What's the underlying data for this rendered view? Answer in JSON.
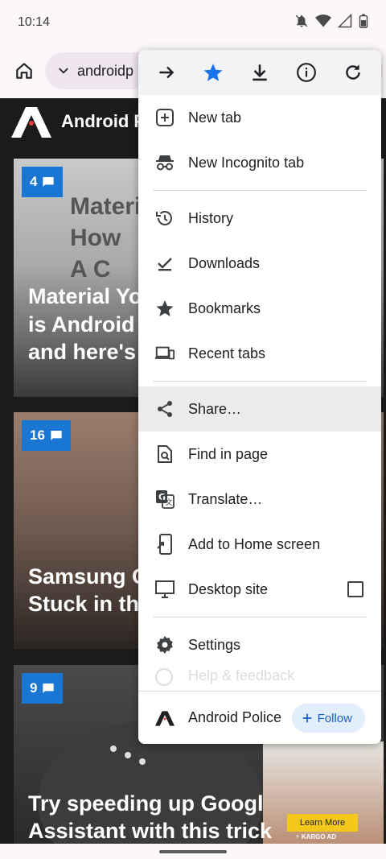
{
  "status": {
    "time": "10:14"
  },
  "toolbar": {
    "url": "androidp"
  },
  "site": {
    "name": "Android P"
  },
  "cards": [
    {
      "comments": "4",
      "bg_line1": "Materi",
      "bg_line2": "How",
      "bg_line3": "A C",
      "headline": "Material Yo\nis Android \nand here's"
    },
    {
      "comments": "16",
      "headline": "Samsung G\nStuck in th"
    },
    {
      "comments": "9",
      "headline": "Try speeding up Googl\nAssistant with this trick",
      "ad_button": "Learn More",
      "ad_label": "⚡ KARGO AD"
    }
  ],
  "menu": {
    "items": {
      "new_tab": "New tab",
      "incognito": "New Incognito tab",
      "history": "History",
      "downloads": "Downloads",
      "bookmarks": "Bookmarks",
      "recent_tabs": "Recent tabs",
      "share": "Share…",
      "find": "Find in page",
      "translate": "Translate…",
      "add_home": "Add to Home screen",
      "desktop": "Desktop site",
      "settings": "Settings",
      "help": "Help & feedback"
    },
    "footer": {
      "title": "Android Police",
      "follow": "Follow"
    }
  },
  "colors": {
    "accent": "#1a73e8",
    "follow_bg": "#e3eefc",
    "badge": "#1976d2"
  }
}
